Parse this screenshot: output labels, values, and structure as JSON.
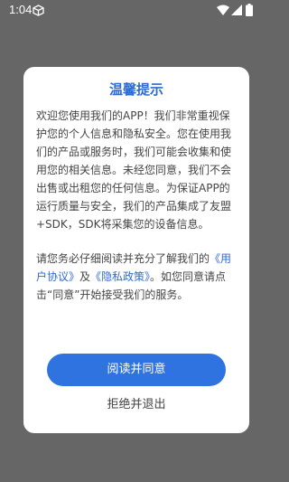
{
  "status_bar": {
    "time": "1:04",
    "icons": [
      "cube-icon",
      "wifi-icon",
      "signal-icon",
      "battery-icon"
    ]
  },
  "dialog": {
    "title": "温馨提示",
    "paragraph1": "欢迎您使用我们的APP！我们非常重视保护您的个人信息和隐私安全。您在使用我们的产品或服务时，我们可能会收集和使用您的相关信息。未经您同意，我们不会出售或出租您的任何信息。为保证APP的运行质量与安全，我们的产品集成了友盟+SDK，SDK将采集您的设备信息。",
    "paragraph2_prefix": "请您务必仔细阅读并充分了解我们的",
    "user_agreement_link": "《用户协议》",
    "conjunction": "及",
    "privacy_policy_link": "《隐私政策》",
    "paragraph2_suffix": "。如您同意请点击“同意”开始接受我们的服务。",
    "agree_button": "阅读并同意",
    "reject_button": "拒绝并退出"
  },
  "colors": {
    "accent": "#2f73e0",
    "link": "#2f6bd3",
    "overlay": "#666666"
  }
}
